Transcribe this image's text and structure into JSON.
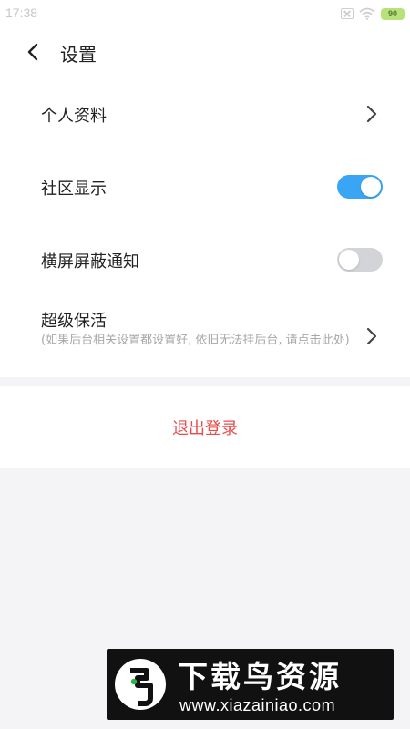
{
  "status_bar": {
    "time": "17:38",
    "battery": "90",
    "icons": [
      "sim-off-icon",
      "wifi-icon",
      "battery-icon"
    ]
  },
  "header": {
    "back_icon": "chevron-left-icon",
    "title": "设置"
  },
  "settings": {
    "items": [
      {
        "label": "个人资料",
        "control": "chevron"
      },
      {
        "label": "社区显示",
        "control": "toggle",
        "value": true
      },
      {
        "label": "横屏屏蔽通知",
        "control": "toggle",
        "value": false
      },
      {
        "label": "超级保活",
        "control": "chevron",
        "description": "(如果后台相关设置都设置好, 依旧无法挂后台, 请点击此处)"
      }
    ]
  },
  "logout": {
    "label": "退出登录"
  },
  "watermark": {
    "title": "下载鸟资源",
    "url": "www.xiazainiao.com"
  },
  "colors": {
    "accent": "#3aa5f5",
    "toggle_off": "#d3d4d8",
    "logout_text": "#e84c4c",
    "background": "#f4f4f6"
  }
}
